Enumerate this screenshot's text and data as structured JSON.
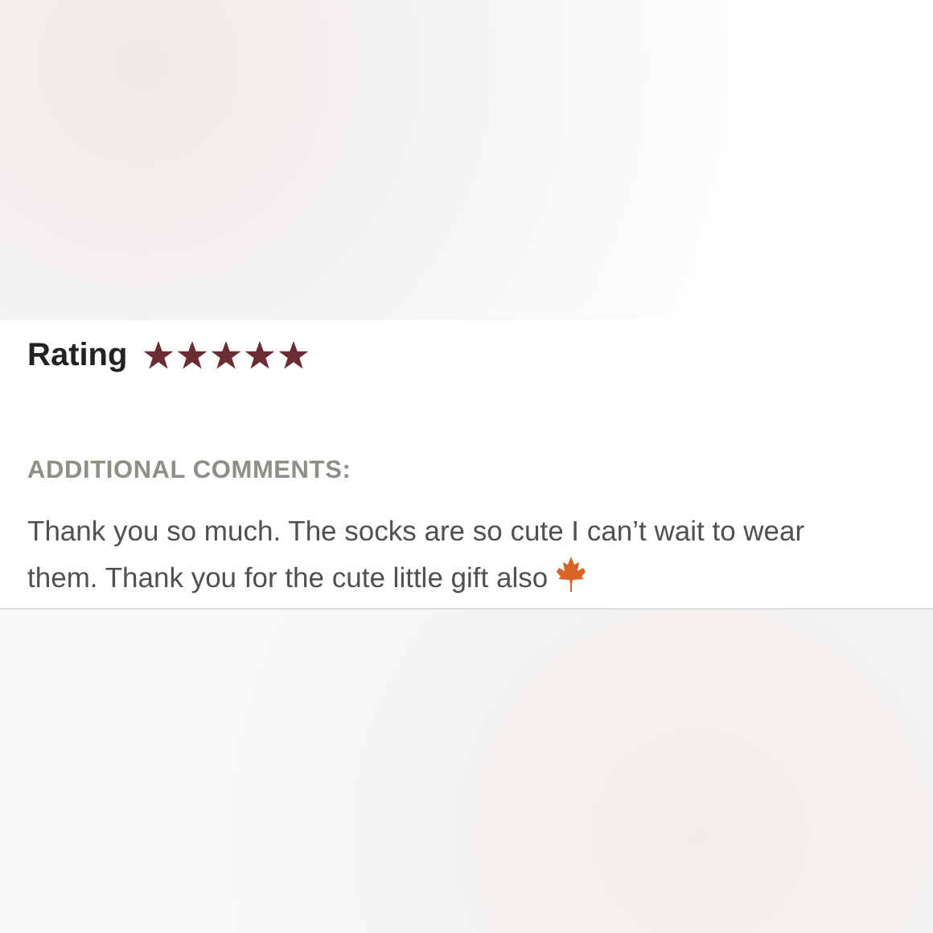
{
  "review": {
    "rating_label": "Rating",
    "stars": 5,
    "comments_label": "ADDITIONAL COMMENTS:",
    "comment": "Thank you so much. The socks are so cute I can’t wait to wear them. Thank you for the cute little gift also"
  }
}
